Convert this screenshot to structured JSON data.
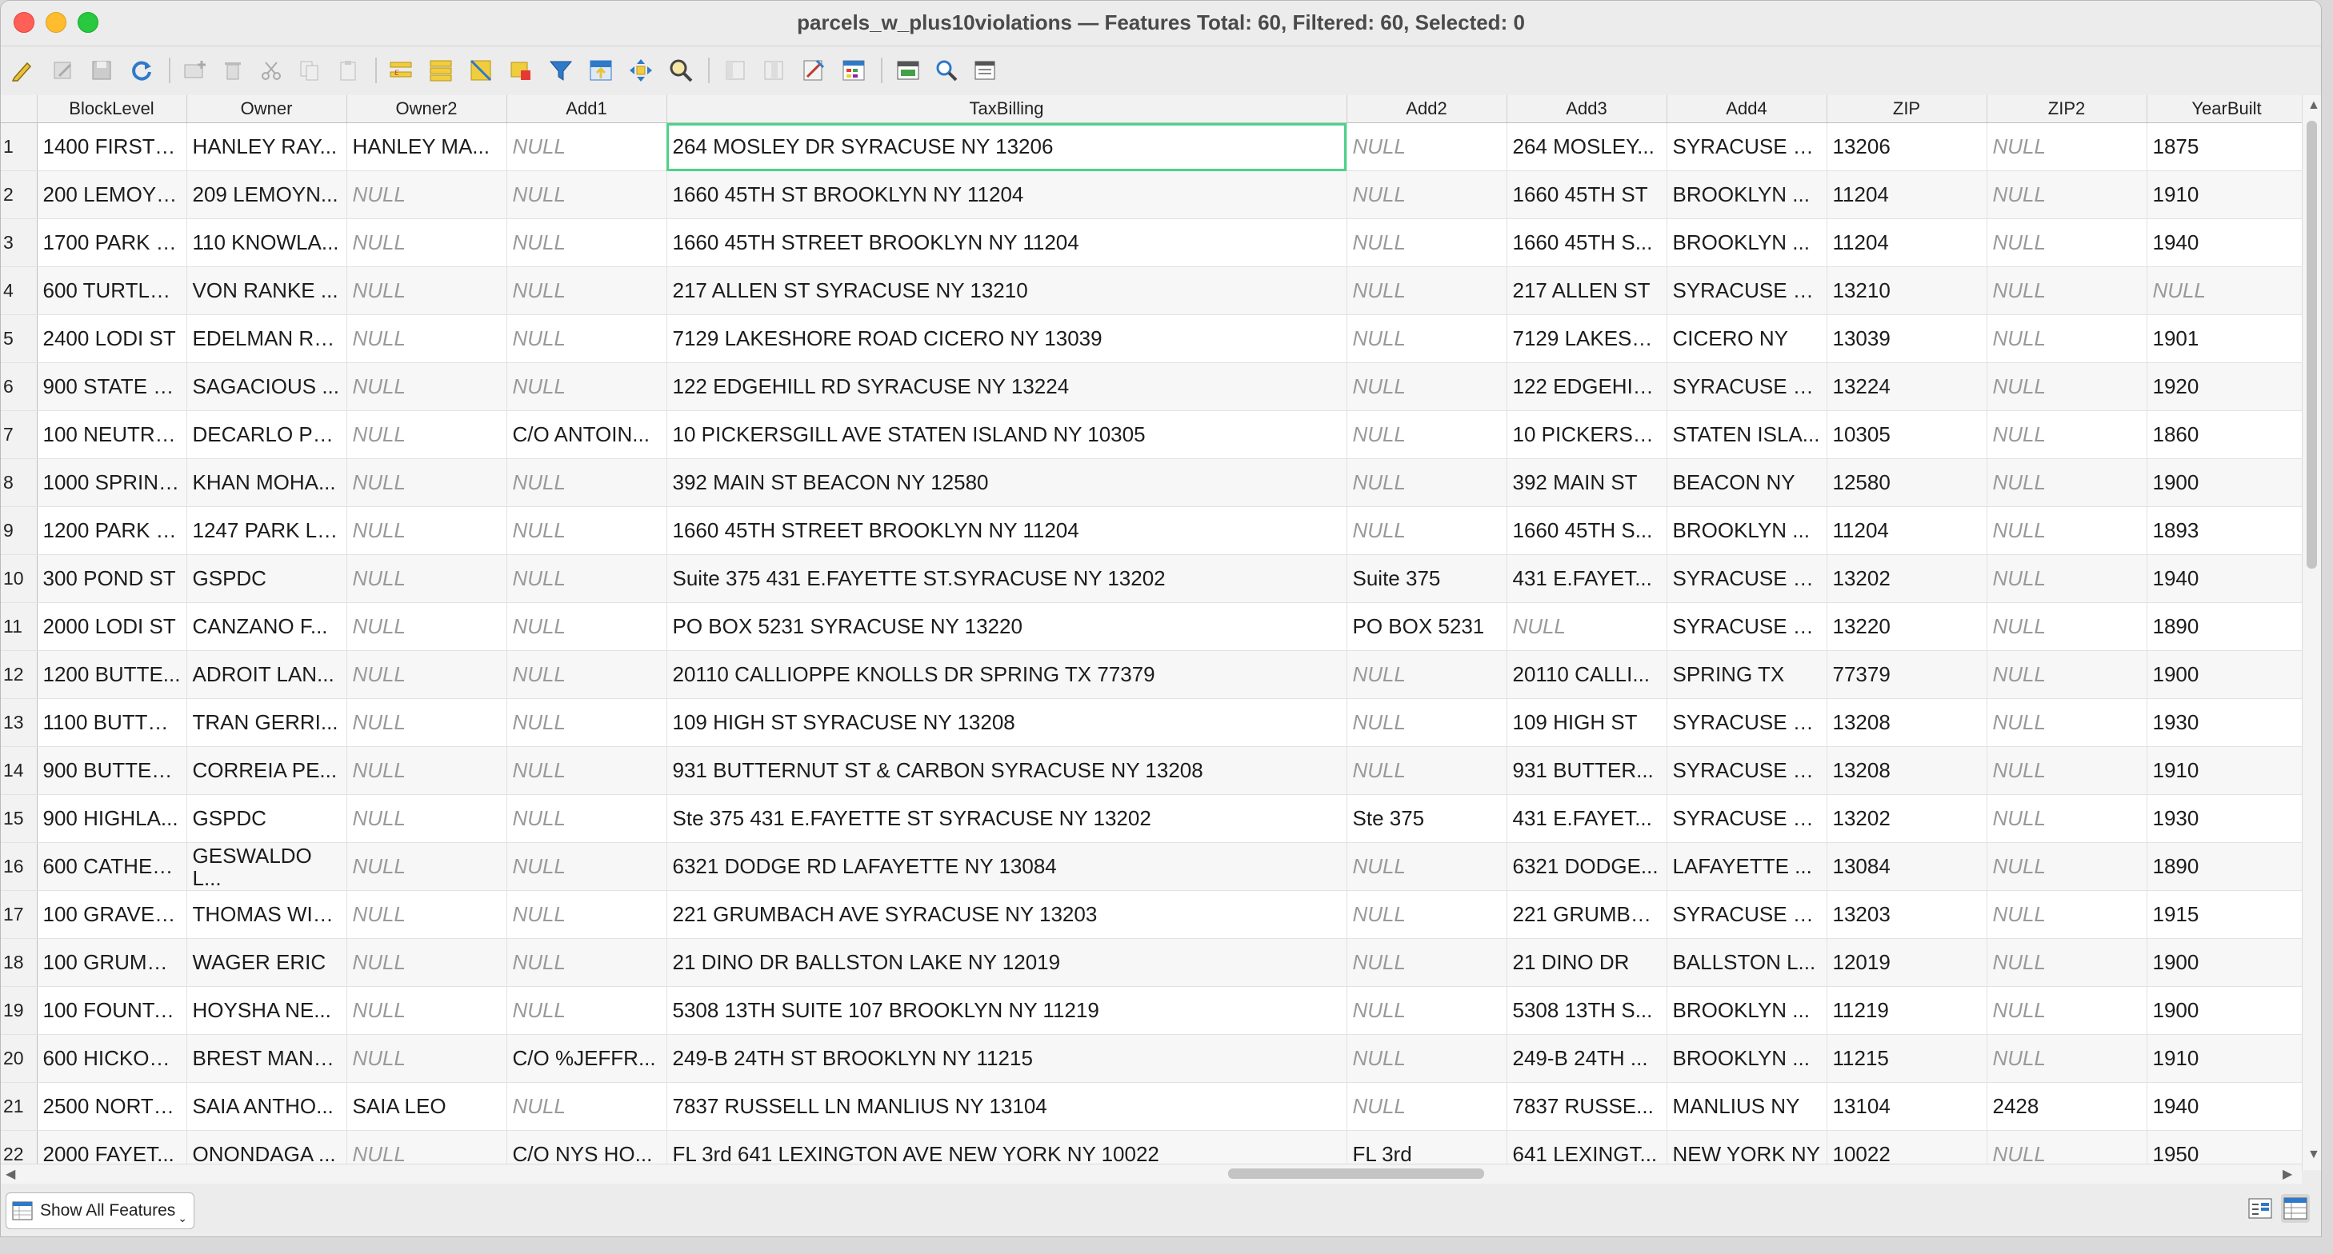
{
  "window": {
    "title": "parcels_w_plus10violations — Features Total: 60, Filtered: 60, Selected: 0"
  },
  "toolbar": {
    "buttons": [
      "pencil-icon",
      "multi-edit-icon",
      "save-icon",
      "reload-icon",
      "add-feature-icon",
      "delete-icon",
      "cut-icon",
      "copy-icon",
      "paste-icon",
      "select-expression-icon",
      "select-all-icon",
      "invert-selection-icon",
      "deselect-all-icon",
      "filter-icon",
      "move-selection-top-icon",
      "pan-to-selected-icon",
      "zoom-to-selected-icon",
      "new-field-icon",
      "delete-field-icon",
      "field-calculator-icon",
      "conditional-formatting-icon",
      "dock-icon",
      "actions-icon",
      "form-view-icon"
    ]
  },
  "table": {
    "columns": [
      "BlockLevel",
      "Owner",
      "Owner2",
      "Add1",
      "TaxBilling",
      "Add2",
      "Add3",
      "Add4",
      "ZIP",
      "ZIP2",
      "YearBuilt"
    ],
    "rows": [
      [
        "1",
        "1400 FIRST N...",
        "HANLEY RAY...",
        "HANLEY MA...",
        "NULL",
        "264 MOSLEY DR SYRACUSE NY 13206",
        "NULL",
        "264 MOSLEY...",
        "SYRACUSE  NY",
        "13206",
        "NULL",
        "1875"
      ],
      [
        "2",
        "200 LEMOYN...",
        "209 LEMOYN...",
        "NULL",
        "NULL",
        "1660 45TH ST BROOKLYN NY 11204",
        "NULL",
        "1660 45TH ST",
        "BROOKLYN  ...",
        "11204",
        "NULL",
        "1910"
      ],
      [
        "3",
        "1700 PARK ST",
        "110 KNOWLA...",
        "NULL",
        "NULL",
        "1660 45TH STREET BROOKLYN NY 11204",
        "NULL",
        "1660 45TH S...",
        "BROOKLYN  ...",
        "11204",
        "NULL",
        "1940"
      ],
      [
        "4",
        "600 TURTLE ...",
        "VON RANKE ...",
        "NULL",
        "NULL",
        "217 ALLEN ST SYRACUSE NY 13210",
        "NULL",
        "217 ALLEN ST",
        "SYRACUSE  NY",
        "13210",
        "NULL",
        "NULL"
      ],
      [
        "5",
        "2400 LODI ST",
        "EDELMAN RE...",
        "NULL",
        "NULL",
        "7129 LAKESHORE ROAD CICERO NY 13039",
        "NULL",
        "7129 LAKESH...",
        "CICERO  NY",
        "13039",
        "NULL",
        "1901"
      ],
      [
        "6",
        "900 STATE S...",
        "SAGACIOUS ...",
        "NULL",
        "NULL",
        "122 EDGEHILL RD SYRACUSE NY 13224",
        "NULL",
        "122 EDGEHIL...",
        "SYRACUSE  NY",
        "13224",
        "NULL",
        "1920"
      ],
      [
        "7",
        "100 NEUTRA...",
        "DECARLO PR...",
        "NULL",
        "C/O ANTOIN...",
        "10 PICKERSGILL AVE STATEN ISLAND NY 10305",
        "NULL",
        "10 PICKERSG...",
        "STATEN ISLA...",
        "10305",
        "NULL",
        "1860"
      ],
      [
        "8",
        "1000 SPRING...",
        "KHAN MOHA...",
        "NULL",
        "NULL",
        "392 MAIN ST BEACON NY 12580",
        "NULL",
        "392 MAIN ST",
        "BEACON  NY",
        "12580",
        "NULL",
        "1900"
      ],
      [
        "9",
        "1200 PARK ST",
        "1247 PARK LLC",
        "NULL",
        "NULL",
        "1660 45TH STREET BROOKLYN NY 11204",
        "NULL",
        "1660 45TH S...",
        "BROOKLYN  ...",
        "11204",
        "NULL",
        "1893"
      ],
      [
        "10",
        "300 POND ST",
        "GSPDC",
        "NULL",
        "NULL",
        "Suite 375 431 E.FAYETTE ST.SYRACUSE NY 13202",
        "Suite 375",
        "431 E.FAYET...",
        "SYRACUSE  NY",
        "13202",
        "NULL",
        "1940"
      ],
      [
        "11",
        "2000 LODI ST",
        "CANZANO F...",
        "NULL",
        "NULL",
        "PO BOX 5231 SYRACUSE NY 13220",
        "PO BOX 5231",
        "NULL",
        "SYRACUSE  NY",
        "13220",
        "NULL",
        "1890"
      ],
      [
        "12",
        "1200 BUTTE...",
        "ADROIT LAN...",
        "NULL",
        "NULL",
        "20110 CALLIOPPE KNOLLS DR SPRING TX 77379",
        "NULL",
        "20110 CALLI...",
        "SPRING  TX",
        "77379",
        "NULL",
        "1900"
      ],
      [
        "13",
        "1100 BUTTER...",
        "TRAN GERRI...",
        "NULL",
        "NULL",
        "109 HIGH ST SYRACUSE NY 13208",
        "NULL",
        "109 HIGH ST",
        "SYRACUSE  NY",
        "13208",
        "NULL",
        "1930"
      ],
      [
        "14",
        "900 BUTTER...",
        "CORREIA PE...",
        "NULL",
        "NULL",
        "931 BUTTERNUT ST & CARBON SYRACUSE NY 13208",
        "NULL",
        "931 BUTTER...",
        "SYRACUSE  NY",
        "13208",
        "NULL",
        "1910"
      ],
      [
        "15",
        "900 HIGHLA...",
        "GSPDC",
        "NULL",
        "NULL",
        "Ste 375 431 E.FAYETTE ST SYRACUSE NY 13202",
        "Ste 375",
        "431 E.FAYET...",
        "SYRACUSE  NY",
        "13202",
        "NULL",
        "1930"
      ],
      [
        "16",
        "600 CATHERI...",
        "GESWALDO L...",
        "NULL",
        "NULL",
        "6321 DODGE RD LAFAYETTE NY 13084",
        "NULL",
        "6321 DODGE...",
        "LAFAYETTE  ...",
        "13084",
        "NULL",
        "1890"
      ],
      [
        "17",
        "100 GRAVES ...",
        "THOMAS WIL...",
        "NULL",
        "NULL",
        "221 GRUMBACH AVE SYRACUSE NY 13203",
        "NULL",
        "221 GRUMBA...",
        "SYRACUSE  NY",
        "13203",
        "NULL",
        "1915"
      ],
      [
        "18",
        "100 GRUMBA...",
        "WAGER ERIC",
        "NULL",
        "NULL",
        "21 DINO DR BALLSTON LAKE NY 12019",
        "NULL",
        "21 DINO DR",
        "BALLSTON L...",
        "12019",
        "NULL",
        "1900"
      ],
      [
        "19",
        "100 FOUNTAI...",
        "HOYSHA NE...",
        "NULL",
        "NULL",
        "5308 13TH SUITE 107 BROOKLYN NY 11219",
        "NULL",
        "5308 13TH S...",
        "BROOKLYN  ...",
        "11219",
        "NULL",
        "1900"
      ],
      [
        "20",
        "600 HICKOR...",
        "BREST MANA...",
        "NULL",
        "C/O %JEFFR...",
        "249-B 24TH ST BROOKLYN NY 11215",
        "NULL",
        "249-B 24TH ...",
        "BROOKLYN  ...",
        "11215",
        "NULL",
        "1910"
      ],
      [
        "21",
        "2500 NORTH...",
        "SAIA ANTHO...",
        "SAIA LEO",
        "NULL",
        "7837 RUSSELL LN MANLIUS NY 13104",
        "NULL",
        "7837 RUSSE...",
        "MANLIUS  NY",
        "13104",
        "2428",
        "1940"
      ],
      [
        "22",
        "2000 FAYET...",
        "ONONDAGA ...",
        "NULL",
        "C/O NYS HO...",
        "FL 3rd 641 LEXINGTON AVE NEW YORK NY 10022",
        "FL    3rd",
        "641 LEXINGT...",
        "NEW YORK  NY",
        "10022",
        "NULL",
        "1950"
      ]
    ]
  },
  "statusbar": {
    "show_all_label": "Show All Features"
  }
}
